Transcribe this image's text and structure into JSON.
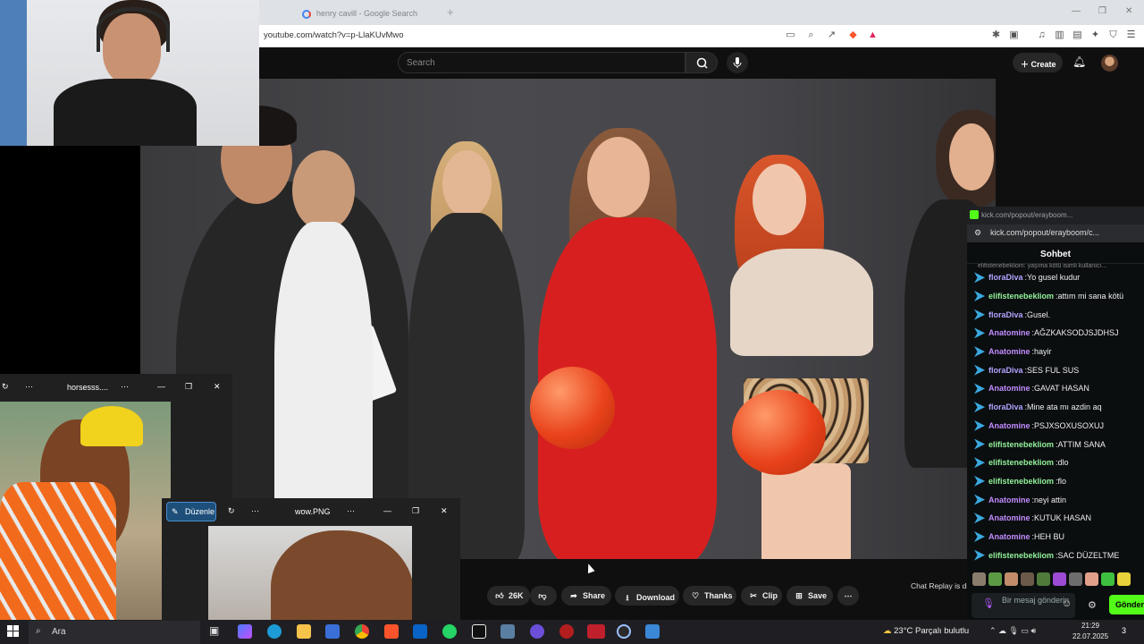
{
  "browser": {
    "tab_title": "henry cavill - Google Search",
    "new_tab": "+",
    "url": "youtube.com/watch?v=p-LlaKUvMwo",
    "min": "—",
    "max": "❐",
    "close": "✕"
  },
  "youtube": {
    "search_placeholder": "Search",
    "create_label": "Create",
    "actions": {
      "like_count": "26K",
      "share": "Share",
      "download": "Download",
      "thanks": "Thanks",
      "clip": "Clip",
      "save": "Save"
    },
    "chat_replay": "Chat Replay is di"
  },
  "chat_window": {
    "title": "kick.com/popout/erayboom...",
    "address": "kick.com/popout/erayboom/c...",
    "header": "Sohbet",
    "truncated_top": "elifistenebekliom: yaşıma kötü isimli kullanıcı...",
    "messages": [
      {
        "user": "floraDiva",
        "text": "Yo gusel kudur",
        "color": "#b1a4ff"
      },
      {
        "user": "elifistenebekliom",
        "text": "attım mi sana kötü",
        "color": "#93f29b"
      },
      {
        "user": "floraDiva",
        "text": "Gusel.",
        "color": "#b1a4ff"
      },
      {
        "user": "Anatomine",
        "text": "AĞZKAKSODJSJDHSJ",
        "color": "#c28cff"
      },
      {
        "user": "Anatomine",
        "text": "hayir",
        "color": "#c28cff"
      },
      {
        "user": "floraDiva",
        "text": "SES FUL SUS",
        "color": "#b1a4ff"
      },
      {
        "user": "Anatomine",
        "text": "GAVAT HASAN",
        "color": "#c28cff"
      },
      {
        "user": "floraDiva",
        "text": "Mine ata mı azdin aq",
        "color": "#b1a4ff"
      },
      {
        "user": "Anatomine",
        "text": "PSJXSOXUSOXUJ",
        "color": "#c28cff"
      },
      {
        "user": "elifistenebekliom",
        "text": "ATTIM SANA",
        "color": "#93f29b"
      },
      {
        "user": "elifistenebekliom",
        "text": "dlo",
        "color": "#93f29b"
      },
      {
        "user": "elifistenebekliom",
        "text": "flo",
        "color": "#93f29b"
      },
      {
        "user": "Anatomine",
        "text": "neyi attin",
        "color": "#c28cff"
      },
      {
        "user": "Anatomine",
        "text": "KUTUK HASAN",
        "color": "#c28cff"
      },
      {
        "user": "Anatomine",
        "text": "HEH BU",
        "color": "#c28cff"
      },
      {
        "user": "elifistenebekliom",
        "text": "SAC DÜZELTME",
        "color": "#93f29b"
      }
    ],
    "input_placeholder": "Bir mesaj gönderin",
    "send_label": "Gönder"
  },
  "viewer1": {
    "title": "horsesss...."
  },
  "viewer2": {
    "title": "wow.PNG",
    "edit_label": "Düzenle"
  },
  "taskbar": {
    "search_label": "Ara",
    "weather": "23°C  Parçalı bulutlu",
    "time": "21:29",
    "date": "22.07.2025",
    "notification_count": "3"
  },
  "colors": {
    "kick_green": "#53fc18",
    "youtube_bg": "#0f0f0f",
    "balloon": "#e9431b"
  }
}
